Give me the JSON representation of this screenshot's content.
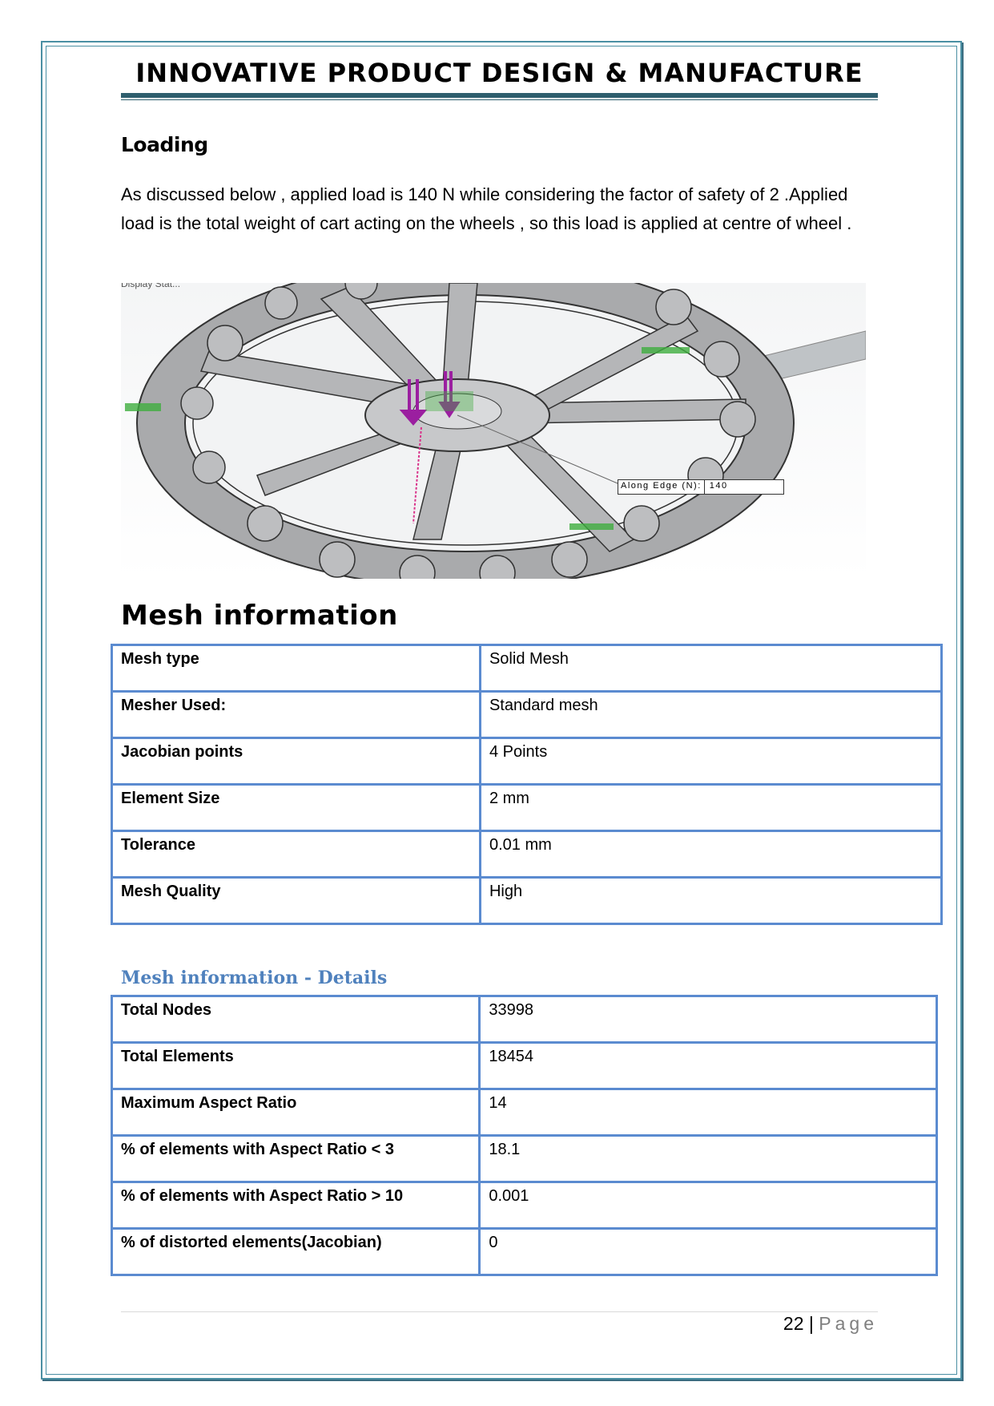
{
  "header": {
    "title": "INNOVATIVE PRODUCT DESIGN & MANUFACTURE"
  },
  "loading": {
    "heading": "Loading",
    "paragraph": "As discussed below , applied load is 140 N while considering the factor of safety of 2 .Applied load is the total weight of cart acting on the wheels , so this load is applied at centre of wheel .",
    "figure": {
      "caption": "Display Stat...",
      "callout_label": "Along Edge (N):",
      "callout_value": "140"
    }
  },
  "mesh_info": {
    "heading": "Mesh information",
    "rows": [
      {
        "key": "Mesh type",
        "value": "Solid Mesh"
      },
      {
        "key": "Mesher Used:",
        "value": "Standard mesh"
      },
      {
        "key": "Jacobian points",
        "value": "4 Points"
      },
      {
        "key": "Element Size",
        "value": "2 mm"
      },
      {
        "key": "Tolerance",
        "value": "0.01 mm"
      },
      {
        "key": "Mesh Quality",
        "value": "High"
      }
    ]
  },
  "mesh_details": {
    "heading": "Mesh information - Details",
    "rows": [
      {
        "key": "Total Nodes",
        "value": "33998"
      },
      {
        "key": "Total Elements",
        "value": "18454"
      },
      {
        "key": "Maximum Aspect Ratio",
        "value": "14"
      },
      {
        "key": "% of elements with Aspect Ratio < 3",
        "value": "18.1"
      },
      {
        "key": "% of elements with Aspect Ratio > 10",
        "value": "0.001"
      },
      {
        "key": "% of distorted elements(Jacobian)",
        "value": "0"
      }
    ]
  },
  "footer": {
    "page_number": "22",
    "separator": "|",
    "page_label": "Page"
  },
  "colors": {
    "frame": "#4a8fa3",
    "title_bar": "#2f5f6e",
    "table_border": "#5b8bd0",
    "details_heading": "#4f81bd",
    "load_arrows": "#9b1fa0",
    "fixtures": "#3fae3f"
  }
}
